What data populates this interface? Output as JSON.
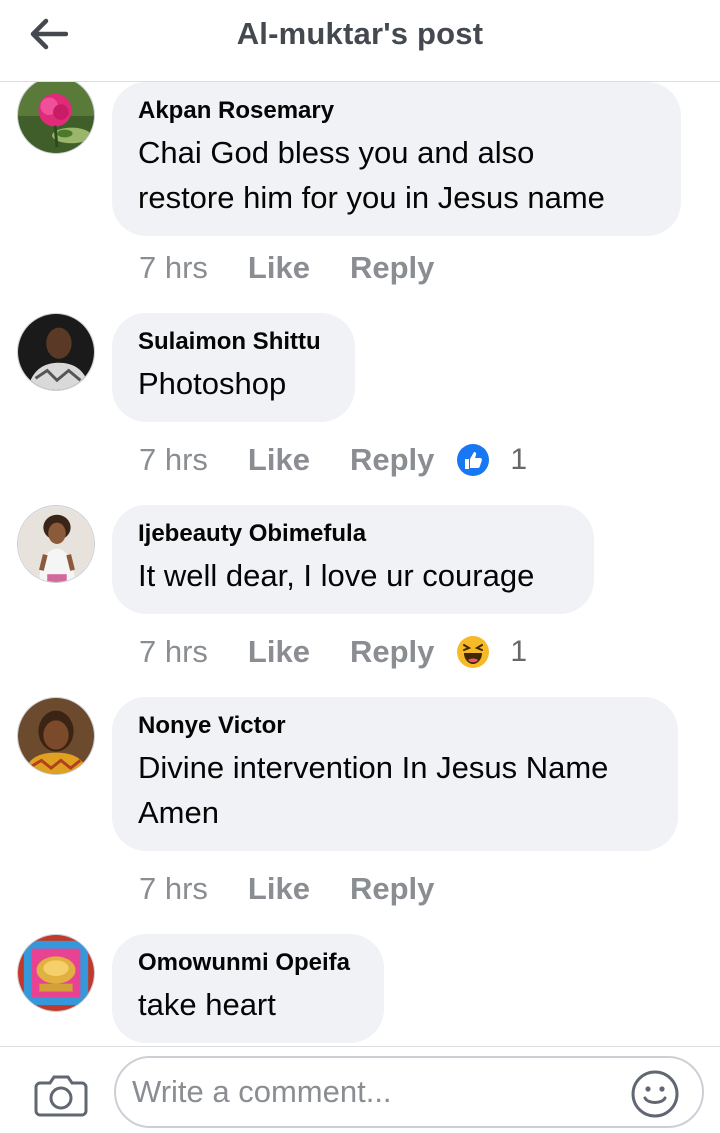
{
  "header": {
    "title": "Al-muktar's post",
    "back_icon": "arrow-left-icon"
  },
  "comments": [
    {
      "author": "Akpan Rosemary",
      "lines": [
        "Chai God bless you and also",
        "restore him for you in Jesus name"
      ],
      "time": "7 hrs",
      "like_label": "Like",
      "reply_label": "Reply"
    },
    {
      "author": "Sulaimon Shittu",
      "lines": [
        "Photoshop"
      ],
      "time": "7 hrs",
      "like_label": "Like",
      "reply_label": "Reply",
      "reaction": {
        "icon": "thumbs-up-icon",
        "count": "1"
      }
    },
    {
      "author": "Ijebeauty Obimefula",
      "lines": [
        "It well dear, I love ur courage"
      ],
      "time": "7 hrs",
      "like_label": "Like",
      "reply_label": "Reply",
      "reaction": {
        "icon": "haha-emoji-icon",
        "count": "1"
      }
    },
    {
      "author": "Nonye Victor",
      "lines": [
        "Divine intervention In Jesus Name",
        "Amen"
      ],
      "time": "7 hrs",
      "like_label": "Like",
      "reply_label": "Reply"
    },
    {
      "author": "Omowunmi Opeifa",
      "lines": [
        "take heart"
      ]
    }
  ],
  "composer": {
    "placeholder": "Write a comment...",
    "camera_icon": "camera-icon",
    "emoji_icon": "smiley-icon"
  },
  "colors": {
    "bubble": "#f0f2f5",
    "meta_text": "#8a8d91",
    "like_blue": "#1877f2",
    "haha_yellow": "#f7b928"
  }
}
